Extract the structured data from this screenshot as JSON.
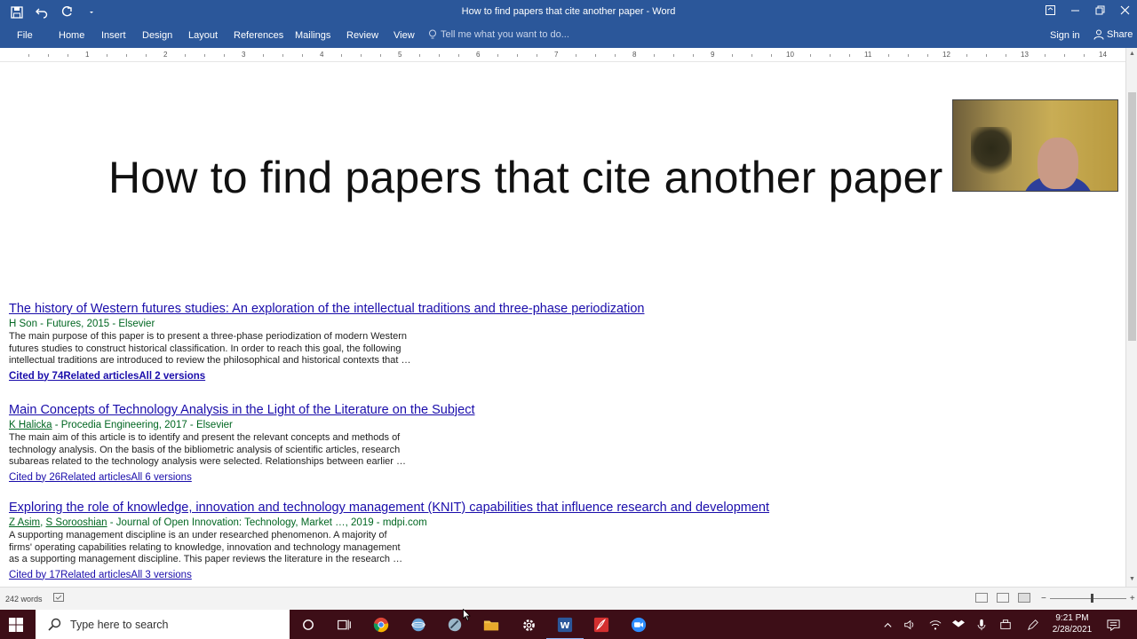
{
  "window": {
    "title": "How to find papers that cite another paper - Word"
  },
  "ribbon": {
    "tabs": [
      "File",
      "Home",
      "Insert",
      "Design",
      "Layout",
      "References",
      "Mailings",
      "Review",
      "View"
    ],
    "tell_me_placeholder": "Tell me what you want to do...",
    "sign_in": "Sign in",
    "share": "Share"
  },
  "ruler": {
    "numbers": [
      "1",
      "2",
      "3",
      "4",
      "5",
      "6",
      "7",
      "8",
      "9",
      "10",
      "11",
      "12",
      "13",
      "14"
    ]
  },
  "document": {
    "heading": "How to find papers that cite another paper",
    "results": [
      {
        "title": "The history of Western futures studies: An exploration of the intellectual traditions and three-phase periodization",
        "authors": [
          "H Son"
        ],
        "meta_rest": " - Futures, 2015 - Elsevier",
        "snippet": "The main purpose of this paper is to present a three-phase periodization of modern Western\nfutures studies to construct historical classification. In order to reach this goal, the following\nintellectual traditions are introduced to review the philosophical and historical contexts that …",
        "links": "Cited by 74Related articlesAll 2 versions"
      },
      {
        "title": "Main Concepts of Technology Analysis in the Light of the Literature on the Subject",
        "authors": [
          "K Halicka"
        ],
        "meta_rest": " - Procedia Engineering, 2017 - Elsevier",
        "snippet": "The main aim of this article is to identify and present the relevant concepts and methods of\ntechnology analysis. On the basis of the bibliometric analysis of scientific articles, research\nsubareas related to the technology analysis were selected. Relationships between earlier …",
        "links": "Cited by 26Related articlesAll 6 versions"
      },
      {
        "title": "Exploring the role of knowledge, innovation and technology management (KNIT) capabilities that influence research and development",
        "authors": [
          "Z Asim",
          "S Sorooshian"
        ],
        "meta_rest": " - Journal of Open Innovation: Technology, Market …, 2019 - mdpi.com",
        "snippet": "A supporting management discipline is an under researched phenomenon. A majority of\nfirms' operating capabilities relating to knowledge, innovation and technology management\nas a supporting management discipline. This paper reviews the literature in the research …",
        "links": "Cited by 17Related articlesAll 3 versions"
      }
    ]
  },
  "status": {
    "word_count": "242 words"
  },
  "taskbar": {
    "search_placeholder": "Type here to search",
    "time": "9:21 PM",
    "date": "2/28/2021"
  },
  "colors": {
    "word_blue": "#2b579a",
    "link_blue": "#1a0dab",
    "meta_green": "#006621",
    "taskbar": "#3d0e17"
  }
}
